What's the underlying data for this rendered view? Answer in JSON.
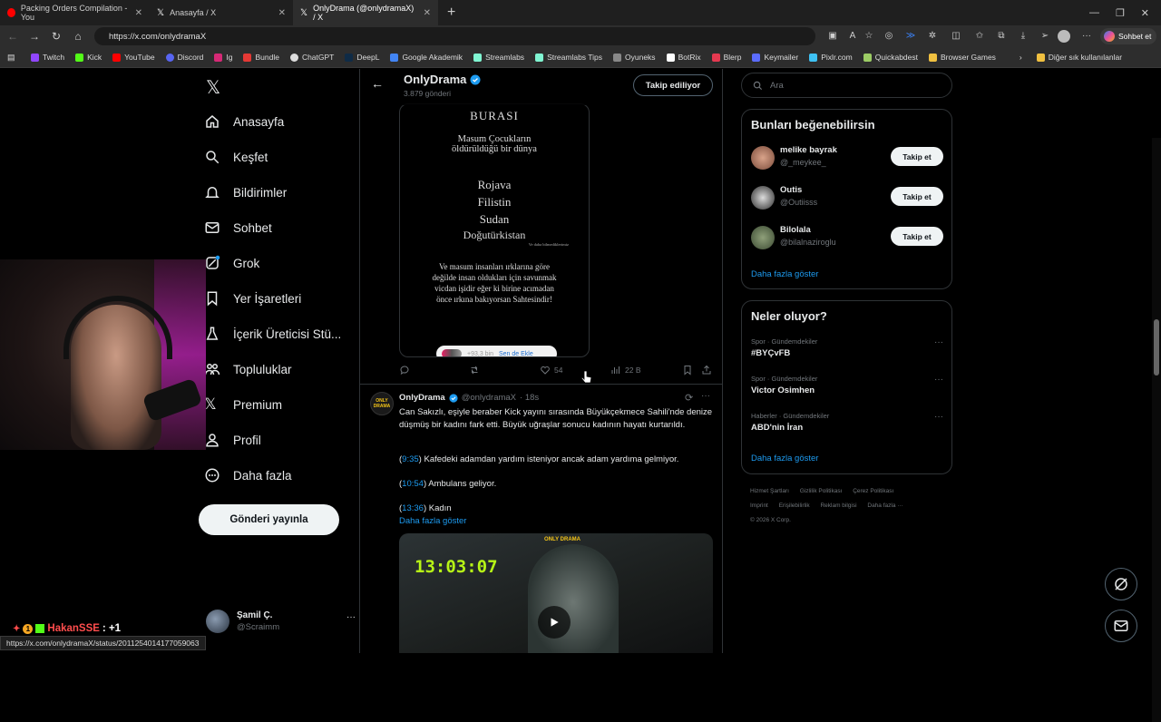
{
  "browser": {
    "tabs": [
      {
        "title": "Packing Orders Compilation - You",
        "close": "✕"
      },
      {
        "title": "Anasayfa / X",
        "close": "✕"
      },
      {
        "title": "OnlyDrama (@onlydramaX) / X",
        "close": "✕"
      }
    ],
    "new_tab": "+",
    "url": "https://x.com/onlydramaX",
    "copilot_label": "Sohbet et",
    "bookmarks": [
      "Twitch",
      "Kick",
      "YouTube",
      "Discord",
      "Ig",
      "Bundle",
      "ChatGPT",
      "DeepL",
      "Google Akademik",
      "Streamlabs",
      "Streamlabs Tips",
      "Oyuneks",
      "BotRix",
      "Blerp",
      "Keymailer",
      "Pixlr.com",
      "Quickabdest",
      "Browser Games"
    ],
    "other_bookmarks": "Diğer sık kullanılanlar",
    "status_url": "https://x.com/onlydramaX/status/2011254014177059063"
  },
  "nav": {
    "items": [
      "Anasayfa",
      "Keşfet",
      "Bildirimler",
      "Sohbet",
      "Grok",
      "Yer İşaretleri",
      "İçerik Üreticisi Stü...",
      "Topluluklar",
      "Premium",
      "Profil",
      "Daha fazla"
    ],
    "post_button": "Gönderi yayınla",
    "account_name": "Şamil Ç.",
    "account_handle": "@Scraimm",
    "more": "···"
  },
  "profile_header": {
    "name": "OnlyDrama",
    "post_count": "3.879 gönderi",
    "follow_label": "Takip ediliyor"
  },
  "post1": {
    "image_text": {
      "heading": "BURASI",
      "line1": "Masum Çocukların",
      "line2": "öldürüldüğü bir dünya",
      "places": [
        "Rojava",
        "Filistin",
        "Sudan",
        "Doğutürkistan"
      ],
      "small": "Ve daha bilmediklerimiz",
      "para": [
        "Ve masum insanları ırklarına göre",
        "değilde insan oldukları için savunmak",
        "vicdan işidir  eğer ki birine acımadan",
        "önce ırkına bakıyorsan Sahtesindir!"
      ],
      "chip_count": "+93,3 bin",
      "chip_label": "Sen de Ekle"
    },
    "likes": "54",
    "views": "22 B"
  },
  "post2": {
    "name": "OnlyDrama",
    "handle": "@onlydramaX",
    "time": "· 18s",
    "text": "Can Sakızlı, eşiyle beraber Kick yayını sırasında Büyükçekmece Sahili'nde denize düşmüş bir kadını fark etti. Büyük uğraşlar sonucu kadının hayatı kurtarıldı.",
    "timestamps": [
      {
        "ts": "9:35",
        "desc": "Kafedeki adamdan yardım isteniyor ancak adam yardıma gelmiyor."
      },
      {
        "ts": "10:54",
        "desc": "Ambulans geliyor."
      },
      {
        "ts": "13:36",
        "desc": "Kadın"
      }
    ],
    "show_more": "Daha fazla göster",
    "video_clock": "13:03:07",
    "video_logo": "ONLY DRAMA"
  },
  "sidebar": {
    "search_placeholder": "Ara",
    "suggest_title": "Bunları beğenebilirsin",
    "suggestions": [
      {
        "name": "melike bayrak",
        "handle": "@_meykee_",
        "button": "Takip et"
      },
      {
        "name": "Outis",
        "handle": "@Outiisss",
        "button": "Takip et"
      },
      {
        "name": "Bilolala",
        "handle": "@bilalnaziroglu",
        "button": "Takip et"
      }
    ],
    "suggest_more": "Daha fazla göster",
    "trends_title": "Neler oluyor?",
    "trends": [
      {
        "context": "Spor · Gündemdekiler",
        "title": "#BYÇvFB"
      },
      {
        "context": "Spor · Gündemdekiler",
        "title": "Victor Osimhen"
      },
      {
        "context": "Haberler · Gündemdekiler",
        "title": "ABD'nin İran"
      }
    ],
    "trends_more": "Daha fazla göster",
    "footer": [
      "Hizmet Şartları",
      "Gizlilik Politikası",
      "Çerez Politikası",
      "Imprint",
      "Erişilebilirlik",
      "Reklam bilgisi",
      "Daha fazla ···",
      "© 2026 X Corp."
    ]
  },
  "stream_overlay": {
    "user": "HakanSSE",
    "suffix": ": +1",
    "badge_count": "1"
  },
  "colors": {
    "accent": "#1d9bf0",
    "background": "#000000",
    "border": "#2f3336",
    "muted": "#71767b"
  }
}
